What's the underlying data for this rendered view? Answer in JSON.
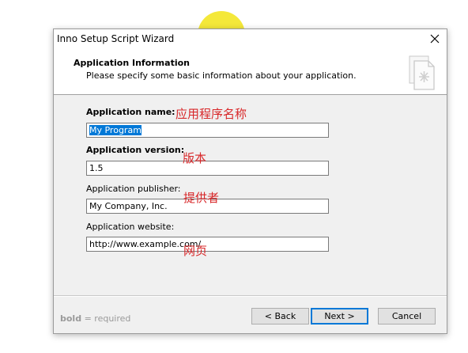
{
  "window": {
    "title": "Inno Setup Script Wizard"
  },
  "header": {
    "title": "Application Information",
    "subtitle": "Please specify some basic information about your application."
  },
  "form": {
    "name_label": "Application name:",
    "name_value": "My Program",
    "version_label": "Application version:",
    "version_value": "1.5",
    "publisher_label": "Application publisher:",
    "publisher_value": "My Company, Inc.",
    "website_label": "Application website:",
    "website_value": "http://www.example.com/"
  },
  "annotations": {
    "name": "应用程序名称",
    "version": "版本",
    "publisher": "提供者",
    "website": "网页"
  },
  "footer": {
    "legend_bold": "bold",
    "legend_rest": " = required",
    "back_label": "< Back",
    "next_label": "Next >",
    "cancel_label": "Cancel"
  },
  "colors": {
    "cursor_highlight": "#f3e629",
    "selection": "#0078d7",
    "annotation": "#d8282a"
  }
}
